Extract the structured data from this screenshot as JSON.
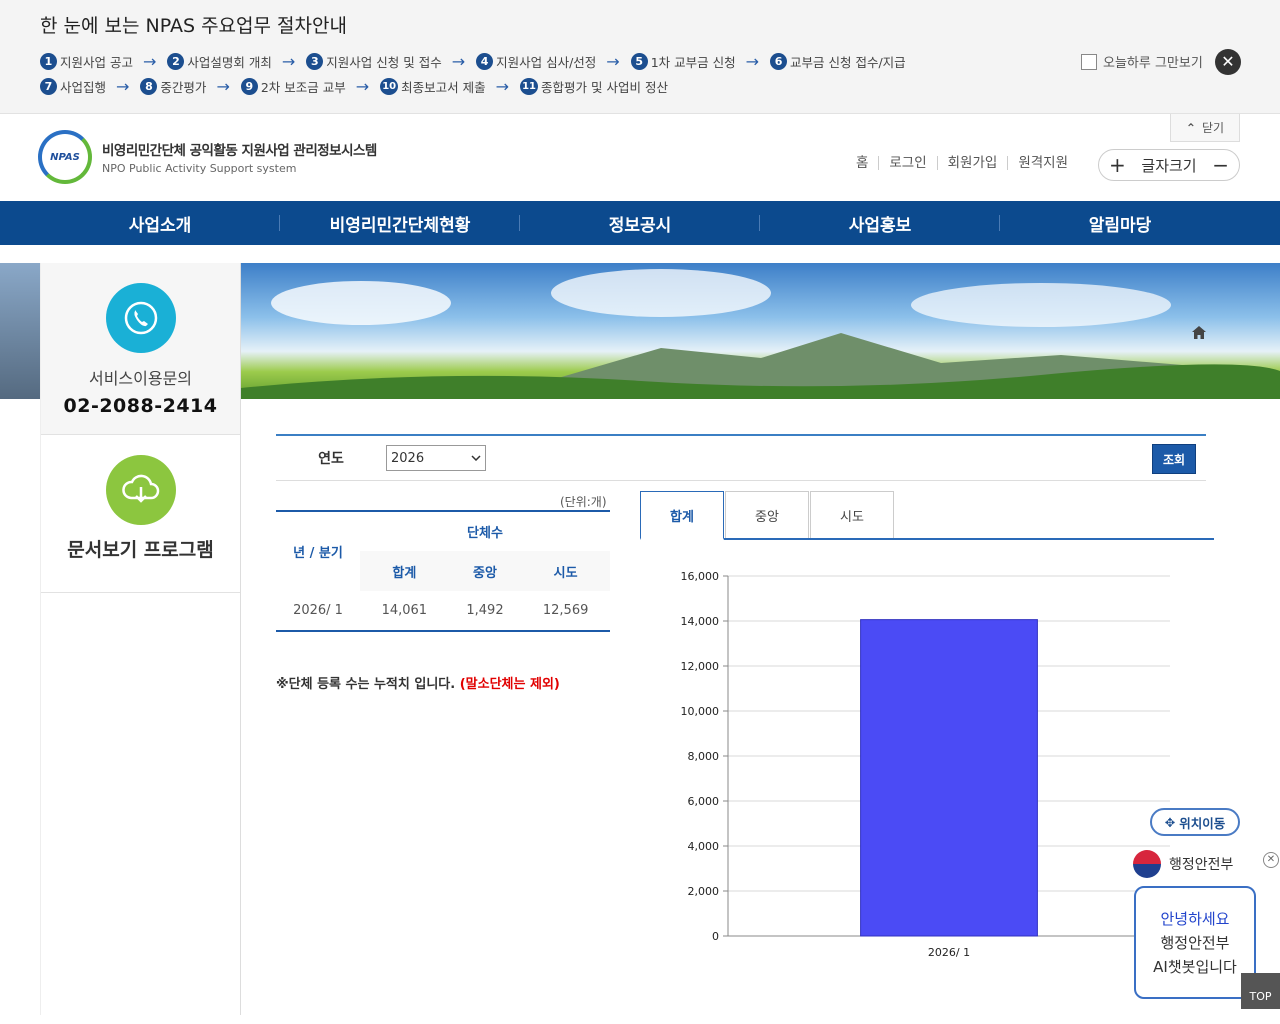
{
  "notice": {
    "title": "한 눈에 보는 NPAS 주요업무 절차안내",
    "row1": [
      {
        "num": "1",
        "label": "지원사업 공고"
      },
      {
        "num": "2",
        "label": "사업설명회 개최"
      },
      {
        "num": "3",
        "label": "지원사업 신청 및 접수"
      },
      {
        "num": "4",
        "label": "지원사업 심사/선정"
      },
      {
        "num": "5",
        "label": "1차 교부금 신청"
      },
      {
        "num": "6",
        "label": "교부금 신청 접수/지급"
      }
    ],
    "row2": [
      {
        "num": "7",
        "label": "사업집행"
      },
      {
        "num": "8",
        "label": "중간평가"
      },
      {
        "num": "9",
        "label": "2차 보조금 교부"
      },
      {
        "num": "10",
        "label": "최종보고서 제출"
      },
      {
        "num": "11",
        "label": "종합평가 및 사업비 정산"
      }
    ],
    "arrow": "→",
    "today_label": "오늘하루 그만보기",
    "close_glyph": "✕"
  },
  "header": {
    "close_tab": "닫기",
    "close_tab_chevron": "⌃",
    "logo_badge": "NPAS",
    "logo_main": "비영리민간단체 공익활동 지원사업 관리정보시스템",
    "logo_sub": "NPO Public Activity Support system",
    "util": [
      "홈",
      "로그인",
      "회원가입",
      "원격지원"
    ],
    "font_plus": "+",
    "font_label": "글자크기",
    "font_minus": "−"
  },
  "gnb": [
    "사업소개",
    "비영리민간단체현황",
    "정보공시",
    "사업홍보",
    "알림마당"
  ],
  "sidebar": {
    "service_label": "서비스이용문의",
    "service_phone": "02-2088-2414",
    "doc_label": "문서보기 프로그램"
  },
  "search": {
    "label": "연도",
    "year": "2026",
    "button": "조회"
  },
  "table": {
    "unit": "(단위:개)",
    "col_group": "단체수",
    "col_year": "년 / 분기",
    "cols": [
      "합계",
      "중앙",
      "시도"
    ],
    "rows": [
      {
        "period": "2026/ 1",
        "total": "14,061",
        "central": "1,492",
        "sido": "12,569"
      }
    ]
  },
  "note": {
    "text": "※단체 등록 수는 누적치 입니다. ",
    "red": "(말소단체는 제외)"
  },
  "tabs": [
    "합계",
    "중앙",
    "시도"
  ],
  "chart_data": {
    "type": "bar",
    "categories": [
      "2026/ 1"
    ],
    "values": [
      14061
    ],
    "ylim": [
      0,
      16000
    ],
    "yticks": [
      0,
      2000,
      4000,
      6000,
      8000,
      10000,
      12000,
      14000,
      16000
    ],
    "ytick_labels": [
      "0",
      "2,000",
      "4,000",
      "6,000",
      "8,000",
      "10,000",
      "12,000",
      "14,000",
      "16,000"
    ],
    "grid": true,
    "bar_color": "#4b4bf5"
  },
  "floating": {
    "position_btn": "위치이동",
    "ministry": "행정안전부",
    "chatbot_hi": "안녕하세요",
    "chatbot_line2": "행정안전부",
    "chatbot_line3": "AI챗봇입니다",
    "top": "TOP"
  }
}
